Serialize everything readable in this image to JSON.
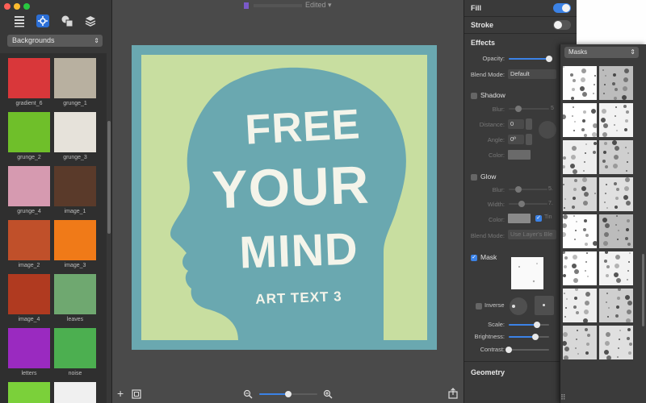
{
  "window": {
    "title": "Edited",
    "doc_icon": "document-icon"
  },
  "left_sidebar": {
    "tools": [
      {
        "name": "list-icon"
      },
      {
        "name": "settings-icon",
        "active": true
      },
      {
        "name": "shapes-icon"
      },
      {
        "name": "layers-icon"
      }
    ],
    "category": "Backgrounds",
    "items": [
      {
        "label": "gradient_6",
        "color": "#d9373a"
      },
      {
        "label": "grunge_1",
        "color": "#b8b0a0"
      },
      {
        "label": "grunge_2",
        "color": "#6fbf2a"
      },
      {
        "label": "grunge_3",
        "color": "#e6e2da"
      },
      {
        "label": "grunge_4",
        "color": "#d69ab0"
      },
      {
        "label": "image_1",
        "color": "#5a3a2a"
      },
      {
        "label": "image_2",
        "color": "#c0502a"
      },
      {
        "label": "image_3",
        "color": "#f07a18"
      },
      {
        "label": "image_4",
        "color": "#b03a20"
      },
      {
        "label": "leaves",
        "color": "#6fa870"
      },
      {
        "label": "letters",
        "color": "#9a2ac0"
      },
      {
        "label": "noise",
        "color": "#4caf50"
      },
      {
        "label": "",
        "color": "#7bd03a"
      },
      {
        "label": "",
        "color": "#f0f0f0"
      }
    ]
  },
  "canvas": {
    "line1": "FREE",
    "line2": "YOUR",
    "line3": "MIND",
    "tag": "ART TEXT 3",
    "border_color": "#6aa8b0",
    "bg_color": "#c8dea0",
    "head_color": "#6aa8b0"
  },
  "zoom": {
    "level": 0.5
  },
  "inspector": {
    "fill": {
      "label": "Fill",
      "on": true
    },
    "stroke": {
      "label": "Stroke",
      "on": false
    },
    "effects": {
      "label": "Effects"
    },
    "opacity": {
      "label": "Opacity:",
      "value": 1.0
    },
    "blend": {
      "label": "Blend Mode:",
      "value": "Default"
    },
    "shadow": {
      "label": "Shadow",
      "checked": false,
      "blur_label": "Blur:",
      "blur_value": "5",
      "distance_label": "Distance:",
      "distance_value": "0",
      "angle_label": "Angle:",
      "angle_value": "0º",
      "color_label": "Color:"
    },
    "glow": {
      "label": "Glow",
      "checked": false,
      "blur_label": "Blur:",
      "blur_value": "5.",
      "width_label": "Width:",
      "width_value": "7.",
      "color_label": "Color:",
      "tint_label": "Tin",
      "blend_label": "Blend Mode:",
      "blend_value": "Use Layer's Ble"
    },
    "mask": {
      "label": "Mask",
      "checked": true,
      "inverse_label": "Inverse",
      "scale_label": "Scale:",
      "scale_value": 0.7,
      "brightness_label": "Brightness:",
      "brightness_value": 0.66,
      "contrast_label": "Contrast:",
      "contrast_value": 0.0
    },
    "geometry": {
      "label": "Geometry"
    }
  },
  "masks_panel": {
    "category": "Masks",
    "count": 16
  }
}
